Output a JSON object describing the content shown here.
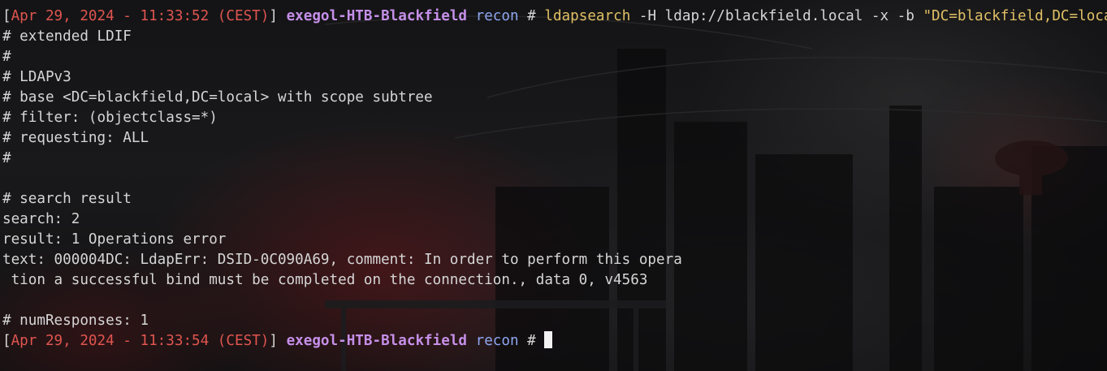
{
  "terminal": {
    "prompt1": {
      "open_bracket": "[",
      "timestamp": "Apr 29, 2024 - 11:33:52 (CEST)",
      "close_bracket": "]",
      "host": "exegol-HTB-Blackfield",
      "dir": "recon",
      "symbol": "#",
      "command": "ldapsearch",
      "args": "-H ldap://blackfield.local -x -b",
      "quoted_arg": "\"DC=blackfield,DC=local\""
    },
    "output": [
      "# extended LDIF",
      "#",
      "# LDAPv3",
      "# base <DC=blackfield,DC=local> with scope subtree",
      "# filter: (objectclass=*)",
      "# requesting: ALL",
      "#",
      "",
      "# search result",
      "search: 2",
      "result: 1 Operations error",
      "text: 000004DC: LdapErr: DSID-0C090A69, comment: In order to perform this opera",
      " tion a successful bind must be completed on the connection., data 0, v4563",
      "",
      "# numResponses: 1"
    ],
    "prompt2": {
      "open_bracket": "[",
      "timestamp": "Apr 29, 2024 - 11:33:54 (CEST)",
      "close_bracket": "]",
      "host": "exegol-HTB-Blackfield",
      "dir": "recon",
      "symbol": "#"
    }
  },
  "colors": {
    "timestamp": "#e0554f",
    "host": "#c58fe8",
    "dir": "#8fa6f0",
    "command": "#e0c065",
    "text": "#d6d6d6",
    "cursor": "#f2f2f2"
  }
}
